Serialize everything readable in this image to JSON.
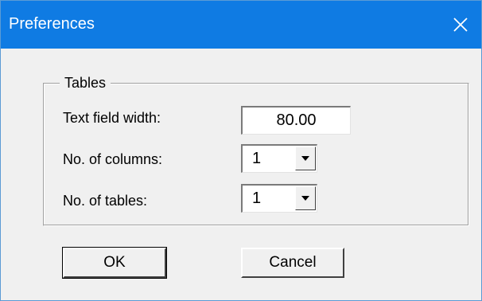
{
  "window": {
    "title": "Preferences",
    "title_bar_color": "#0f7be3"
  },
  "icons": {
    "close": "close-icon",
    "dropdown": "chevron-down-icon"
  },
  "tables_group": {
    "legend": "Tables",
    "text_field_width": {
      "label": "Text field width:",
      "value": "80.00"
    },
    "no_of_columns": {
      "label": "No. of columns:",
      "value": "1"
    },
    "no_of_tables": {
      "label": "No. of tables:",
      "value": "1"
    }
  },
  "buttons": {
    "ok": "OK",
    "cancel": "Cancel"
  }
}
